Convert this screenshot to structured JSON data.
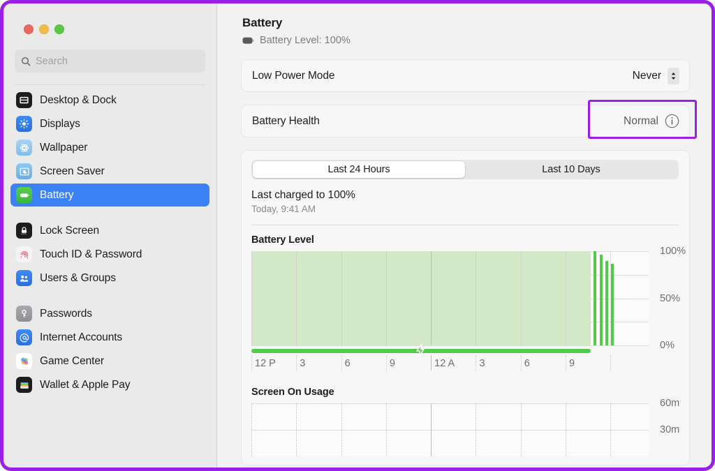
{
  "window": {
    "traffic_lights": [
      "close",
      "minimize",
      "zoom"
    ],
    "accent_highlight": "#9b1fe8"
  },
  "search": {
    "placeholder": "Search",
    "value": "",
    "icon": "search-icon"
  },
  "sidebar": {
    "groups": [
      {
        "items": [
          {
            "label": "Desktop & Dock",
            "icon": "desktop-dock-icon",
            "selected": false
          },
          {
            "label": "Displays",
            "icon": "displays-icon",
            "selected": false
          },
          {
            "label": "Wallpaper",
            "icon": "wallpaper-icon",
            "selected": false
          },
          {
            "label": "Screen Saver",
            "icon": "screen-saver-icon",
            "selected": false
          },
          {
            "label": "Battery",
            "icon": "battery-icon",
            "selected": true
          }
        ]
      },
      {
        "items": [
          {
            "label": "Lock Screen",
            "icon": "lock-icon",
            "selected": false
          },
          {
            "label": "Touch ID & Password",
            "icon": "touch-id-icon",
            "selected": false
          },
          {
            "label": "Users & Groups",
            "icon": "users-icon",
            "selected": false
          }
        ]
      },
      {
        "items": [
          {
            "label": "Passwords",
            "icon": "key-icon",
            "selected": false
          },
          {
            "label": "Internet Accounts",
            "icon": "at-sign-icon",
            "selected": false
          },
          {
            "label": "Game Center",
            "icon": "game-center-icon",
            "selected": false
          },
          {
            "label": "Wallet & Apple Pay",
            "icon": "wallet-icon",
            "selected": false
          }
        ]
      }
    ]
  },
  "main": {
    "title": "Battery",
    "battery_level_icon": "battery-full-icon",
    "battery_level_text": "Battery Level: 100%",
    "low_power_mode": {
      "label": "Low Power Mode",
      "value": "Never",
      "stepper_icon": "up-down-chevron-icon"
    },
    "battery_health": {
      "label": "Battery Health",
      "value": "Normal",
      "info_icon": "info-circle-icon"
    },
    "segmented": {
      "options": [
        "Last 24 Hours",
        "Last 10 Days"
      ],
      "selected_index": 0
    },
    "last_charged": {
      "title": "Last charged to 100%",
      "subtitle": "Today, 9:41 AM"
    }
  },
  "chart_data": [
    {
      "type": "area",
      "title": "Battery Level",
      "xlabel": "",
      "ylabel": "",
      "ylim": [
        0,
        100
      ],
      "y_ticks": [
        0,
        50,
        100
      ],
      "y_tick_labels": [
        "0%",
        "50%",
        "100%"
      ],
      "y_gridlines": [
        0,
        25,
        50,
        75,
        100
      ],
      "x_tick_labels": [
        "12 P",
        "3",
        "6",
        "9",
        "12 A",
        "3",
        "6",
        "9"
      ],
      "grid": true,
      "legend": "none",
      "area_fill_color": "#d3e8c6",
      "bar_color": "#54ca4b",
      "area_end_fraction": 0.855,
      "bars": [
        {
          "x_fraction": 0.862,
          "value": 100
        },
        {
          "x_fraction": 0.877,
          "value": 96
        },
        {
          "x_fraction": 0.891,
          "value": 90
        },
        {
          "x_fraction": 0.905,
          "value": 87
        }
      ],
      "charging_line": {
        "label": "charging",
        "icon": "lightning-bolt-icon",
        "end_fraction": 0.855,
        "bolt_x_fraction": 0.425,
        "color": "#54ca4b"
      }
    },
    {
      "type": "area",
      "title": "Screen On Usage",
      "xlabel": "",
      "ylabel": "",
      "ylim": [
        0,
        60
      ],
      "y_tick_labels": [
        "60m",
        "30m"
      ],
      "y_gridlines": [
        60,
        30
      ],
      "values": [],
      "grid": true,
      "legend": "none",
      "note": "chart clipped by window bottom edge"
    }
  ]
}
